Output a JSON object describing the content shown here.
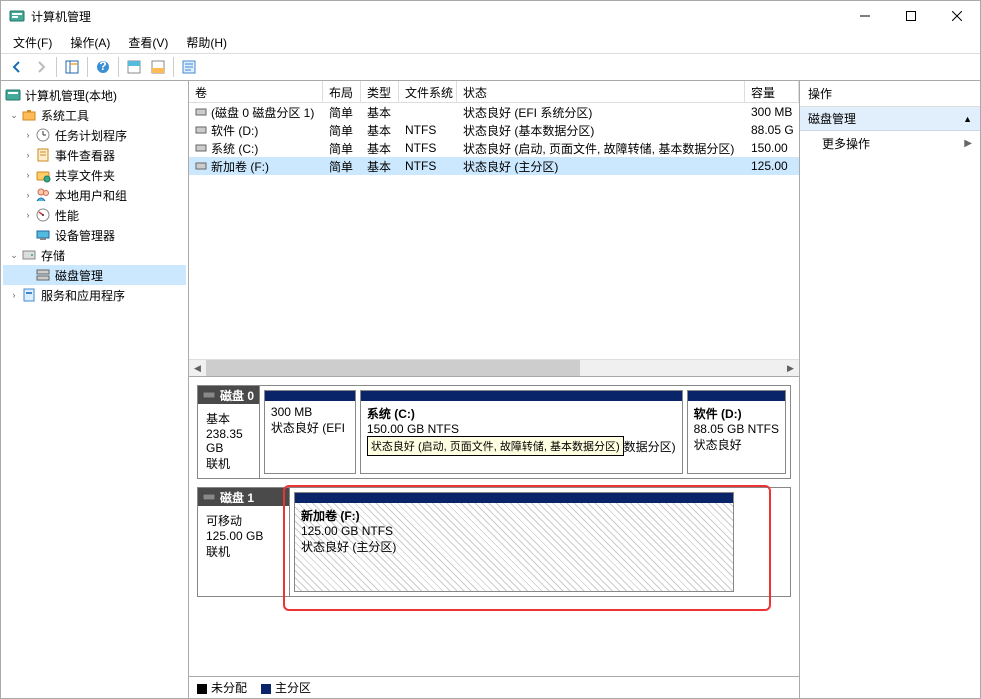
{
  "window": {
    "title": "计算机管理",
    "min": "minimize",
    "max": "maximize",
    "close": "close"
  },
  "menu": {
    "file": "文件(F)",
    "action": "操作(A)",
    "view": "查看(V)",
    "help": "帮助(H)"
  },
  "nav": {
    "root": "计算机管理(本地)",
    "systools": "系统工具",
    "task": "任务计划程序",
    "event": "事件查看器",
    "shared": "共享文件夹",
    "users": "本地用户和组",
    "perf": "性能",
    "devmgr": "设备管理器",
    "storage": "存储",
    "diskmgmt": "磁盘管理",
    "services": "服务和应用程序"
  },
  "cols": {
    "vol": "卷",
    "layout": "布局",
    "type": "类型",
    "fs": "文件系统",
    "status": "状态",
    "capacity": "容量"
  },
  "rows": [
    {
      "vol": "(磁盘 0 磁盘分区 1)",
      "layout": "简单",
      "type": "基本",
      "fs": "",
      "status": "状态良好 (EFI 系统分区)",
      "cap": "300 MB"
    },
    {
      "vol": "软件 (D:)",
      "layout": "简单",
      "type": "基本",
      "fs": "NTFS",
      "status": "状态良好 (基本数据分区)",
      "cap": "88.05 G"
    },
    {
      "vol": "系统 (C:)",
      "layout": "简单",
      "type": "基本",
      "fs": "NTFS",
      "status": "状态良好 (启动, 页面文件, 故障转储, 基本数据分区)",
      "cap": "150.00"
    },
    {
      "vol": "新加卷 (F:)",
      "layout": "简单",
      "type": "基本",
      "fs": "NTFS",
      "status": "状态良好 (主分区)",
      "cap": "125.00"
    }
  ],
  "disks": {
    "d0": {
      "name": "磁盘 0",
      "type": "基本",
      "size": "238.35 GB",
      "status": "联机"
    },
    "d1": {
      "name": "磁盘 1",
      "type": "可移动",
      "size": "125.00 GB",
      "status": "联机"
    }
  },
  "parts": {
    "p0": {
      "name": "",
      "size": "300 MB",
      "status": "状态良好 (EFI"
    },
    "p1": {
      "name": "系统  (C:)",
      "size": "150.00 GB NTFS",
      "status": "状态良好 (启动, 页面文件, 故障转储, 基本数据分区)",
      "status_short": "数据分区)"
    },
    "p2": {
      "name": "软件  (D:)",
      "size": "88.05 GB NTFS",
      "status": "状态良好"
    },
    "p3": {
      "name": "新加卷  (F:)",
      "size": "125.00 GB NTFS",
      "status": "状态良好 (主分区)"
    }
  },
  "tooltip": "状态良好 (启动, 页面文件, 故障转储, 基本数据分区)",
  "legend": {
    "unalloc": "未分配",
    "primary": "主分区"
  },
  "actions": {
    "title": "操作",
    "group": "磁盘管理",
    "more": "更多操作"
  }
}
